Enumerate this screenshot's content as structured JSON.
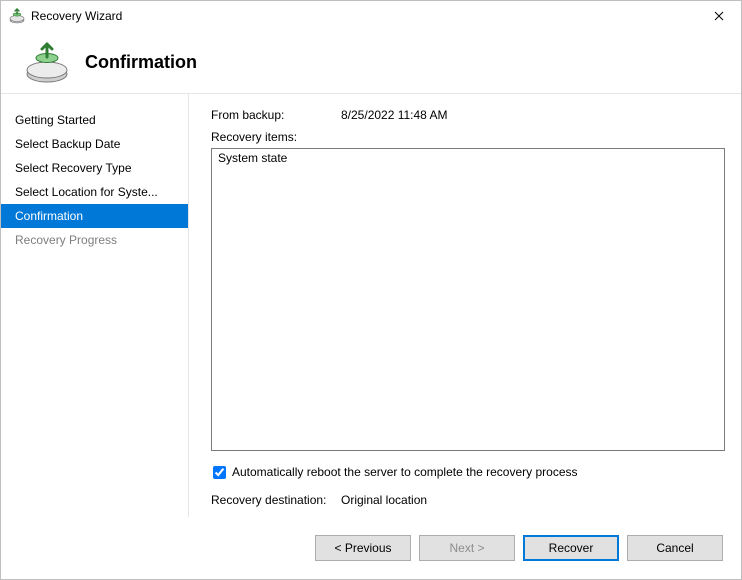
{
  "window": {
    "title": "Recovery Wizard"
  },
  "header": {
    "title": "Confirmation"
  },
  "sidebar": {
    "items": [
      {
        "label": "Getting Started",
        "state": "normal"
      },
      {
        "label": "Select Backup Date",
        "state": "normal"
      },
      {
        "label": "Select Recovery Type",
        "state": "normal"
      },
      {
        "label": "Select Location for Syste...",
        "state": "normal"
      },
      {
        "label": "Confirmation",
        "state": "selected"
      },
      {
        "label": "Recovery Progress",
        "state": "disabled"
      }
    ]
  },
  "content": {
    "from_backup_label": "From backup:",
    "from_backup_value": "8/25/2022 11:48 AM",
    "recovery_items_label": "Recovery items:",
    "recovery_items": [
      "System state"
    ],
    "reboot_checkbox_label": "Automatically reboot the server to complete the recovery process",
    "reboot_checkbox_checked": true,
    "destination_label": "Recovery destination:",
    "destination_value": "Original location"
  },
  "buttons": {
    "previous": "< Previous",
    "next": "Next >",
    "recover": "Recover",
    "cancel": "Cancel"
  }
}
